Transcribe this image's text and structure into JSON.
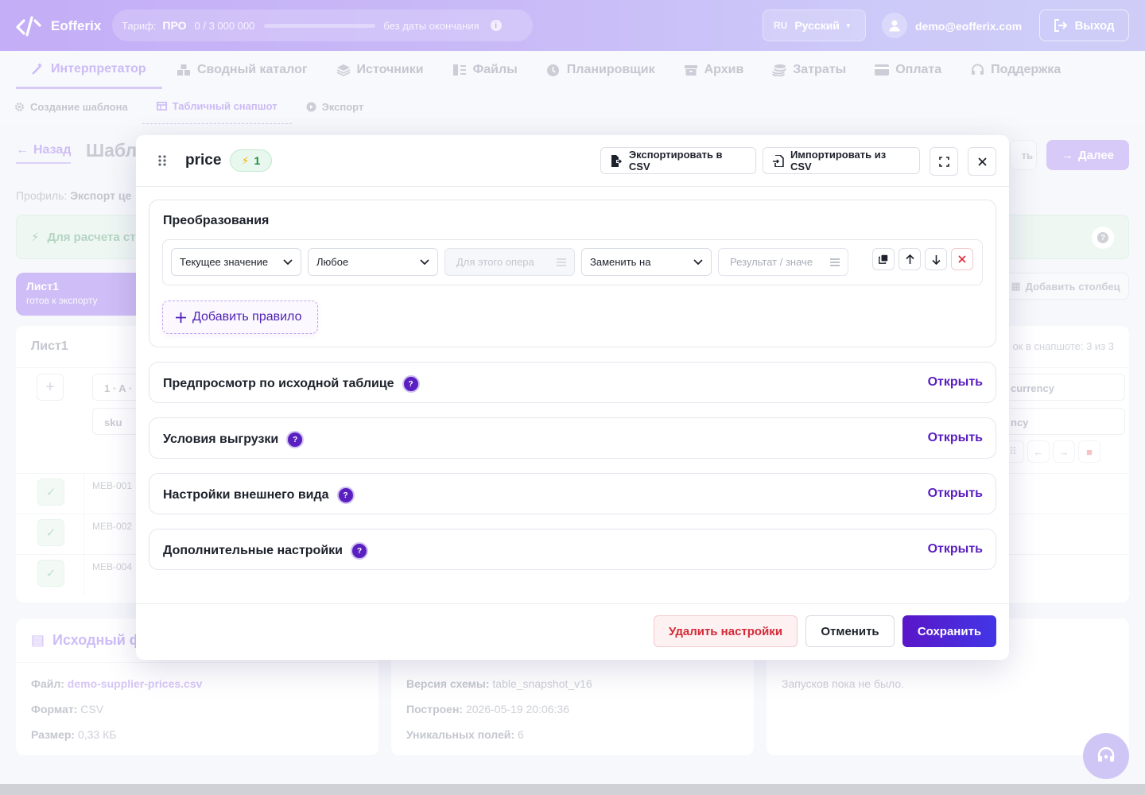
{
  "header": {
    "brand": "Eofferix",
    "tariff_label": "Тариф:",
    "tariff_plan": "ПРО",
    "tariff_usage": "0 / 3 000 000",
    "tariff_usage_fraction": 0,
    "tariff_expiry": "без даты окончания",
    "lang_code": "RU",
    "lang_name": "Русский",
    "user_email": "demo@eofferix.com",
    "logout_label": "Выход"
  },
  "nav": {
    "items": [
      {
        "label": "Интерпретатор",
        "icon": "magic-wand-icon",
        "active": true
      },
      {
        "label": "Сводный каталог",
        "icon": "boxes-icon"
      },
      {
        "label": "Источники",
        "icon": "layers-icon"
      },
      {
        "label": "Файлы",
        "icon": "files-icon"
      },
      {
        "label": "Планировщик",
        "icon": "clock-icon"
      },
      {
        "label": "Архив",
        "icon": "archive-icon"
      },
      {
        "label": "Затраты",
        "icon": "coins-icon"
      },
      {
        "label": "Оплата",
        "icon": "credit-card-icon"
      },
      {
        "label": "Поддержка",
        "icon": "headset-icon"
      }
    ],
    "sub": [
      {
        "label": "Создание шаблона",
        "icon": "gear-icon"
      },
      {
        "label": "Табличный снапшот",
        "icon": "table-icon",
        "active": true
      },
      {
        "label": "Экспорт",
        "icon": "play-icon"
      }
    ]
  },
  "page": {
    "back_label": "Назад",
    "title": "Шабл",
    "profile_label": "Профиль:",
    "profile_value": "Экспорт це",
    "alert_text": "Для расчета ст",
    "next_label": "Далее",
    "prev_partial": "ть",
    "sheet_name": "Лист1",
    "sheet_status": "готов к экспорту",
    "add_column_label": "Добавить столбец",
    "grid_title": "Лист1",
    "grid_count": "ок в снапшоте: 3 из 3",
    "col_header": "1 · A ·",
    "col_field": "sku",
    "right_col_header": "currency",
    "right_col_field": "ncy",
    "rows": [
      "MEB-001",
      "MEB-002",
      "MEB-004"
    ],
    "cards": {
      "source_title": "Исходный ф",
      "file_label": "Файл:",
      "file_value": "demo-supplier-prices.csv",
      "format_label": "Формат:",
      "format_value": "CSV",
      "size_label": "Размер:",
      "size_value": "0,33 КБ",
      "schema_label": "Версия схемы:",
      "schema_value": "table_snapshot_v16",
      "built_label": "Построен:",
      "built_value": "2026-05-19 20:06:36",
      "unique_label": "Уникальных полей:",
      "unique_value": "6",
      "runs_text": "Запусков пока не было."
    }
  },
  "modal": {
    "title": "price",
    "badge_count": "1",
    "export_csv_label": "Экспортировать в CSV",
    "import_csv_label": "Импортировать из CSV",
    "transform_title": "Преобразования",
    "rule": {
      "source": "Текущее значение",
      "condition": "Любое",
      "operand_placeholder": "Для этого опера",
      "action": "Заменить на",
      "result_placeholder": "Результат / значе"
    },
    "add_rule_label": "Добавить правило",
    "sections": [
      {
        "title": "Предпросмотр по исходной таблице",
        "action": "Открыть"
      },
      {
        "title": "Условия выгрузки",
        "action": "Открыть"
      },
      {
        "title": "Настройки внешнего вида",
        "action": "Открыть"
      },
      {
        "title": "Дополнительные настройки",
        "action": "Открыть"
      }
    ],
    "delete_label": "Удалить настройки",
    "cancel_label": "Отменить",
    "save_label": "Сохранить"
  }
}
